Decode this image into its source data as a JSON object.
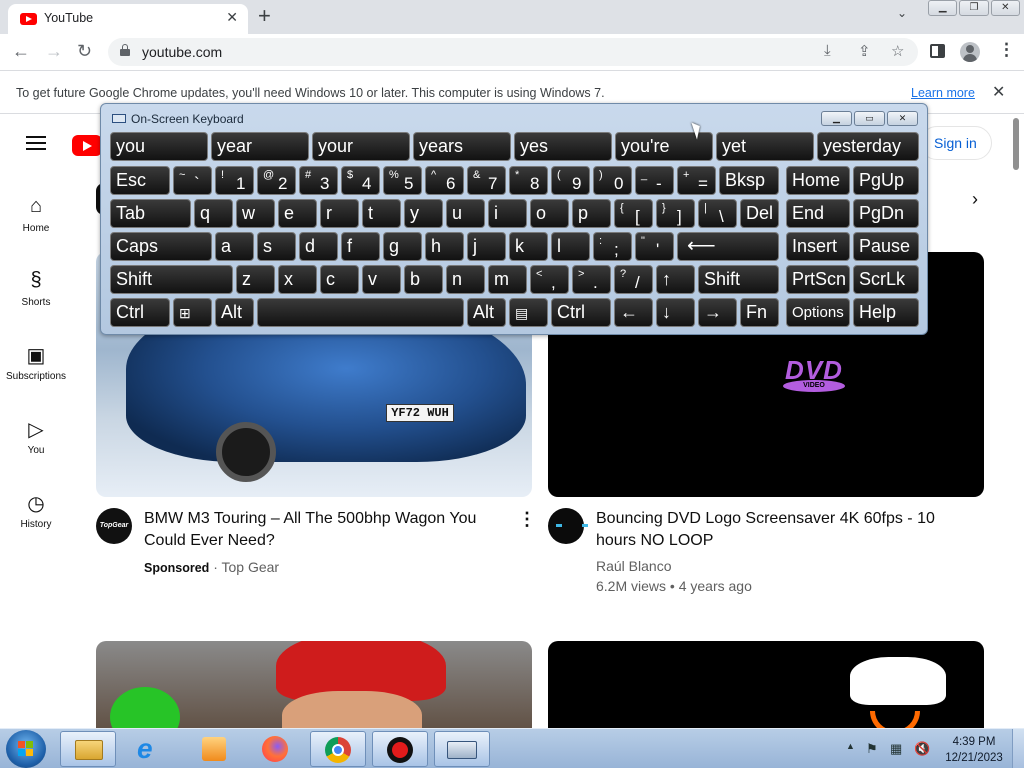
{
  "browser": {
    "tab_title": "YouTube",
    "url": "youtube.com",
    "infobar_text": "To get future Google Chrome updates, you'll need Windows 10 or later. This computer is using Windows 7.",
    "infobar_link": "Learn more"
  },
  "youtube": {
    "sign_in": "Sign in",
    "sidebar": [
      {
        "label": "Home",
        "icon": "home-icon"
      },
      {
        "label": "Shorts",
        "icon": "shorts-icon"
      },
      {
        "label": "Subscriptions",
        "icon": "subscriptions-icon"
      },
      {
        "label": "You",
        "icon": "you-icon"
      },
      {
        "label": "History",
        "icon": "history-icon"
      }
    ],
    "chip_partial": "ct",
    "videos": [
      {
        "title": "BMW M3 Touring – All The 500bhp Wagon You Could Ever Need?",
        "badge": "Sponsored",
        "channel": "Top Gear",
        "avatar_text": "TopGear",
        "plate": "YF72 WUH"
      },
      {
        "title": "Bouncing DVD Logo Screensaver 4K 60fps - 10 hours NO LOOP",
        "channel": "Raúl Blanco",
        "views": "6.2M views • 4 years ago",
        "logo_text": "DVD",
        "logo_sub": "VIDEO"
      }
    ]
  },
  "osk": {
    "title": "On-Screen Keyboard",
    "suggestions": [
      "you",
      "year",
      "your",
      "years",
      "yes",
      "you're",
      "yet",
      "yesterday"
    ],
    "keys": {
      "esc": "Esc",
      "bksp": "Bksp",
      "home": "Home",
      "pgup": "PgUp",
      "tab": "Tab",
      "del": "Del",
      "end": "End",
      "pgdn": "PgDn",
      "caps": "Caps",
      "insert": "Insert",
      "pause": "Pause",
      "shift": "Shift",
      "prtscn": "PrtScn",
      "scrlk": "ScrLk",
      "ctrl": "Ctrl",
      "alt": "Alt",
      "fn": "Fn",
      "options": "Options",
      "help": "Help"
    }
  },
  "taskbar": {
    "time": "4:39 PM",
    "date": "12/21/2023"
  }
}
